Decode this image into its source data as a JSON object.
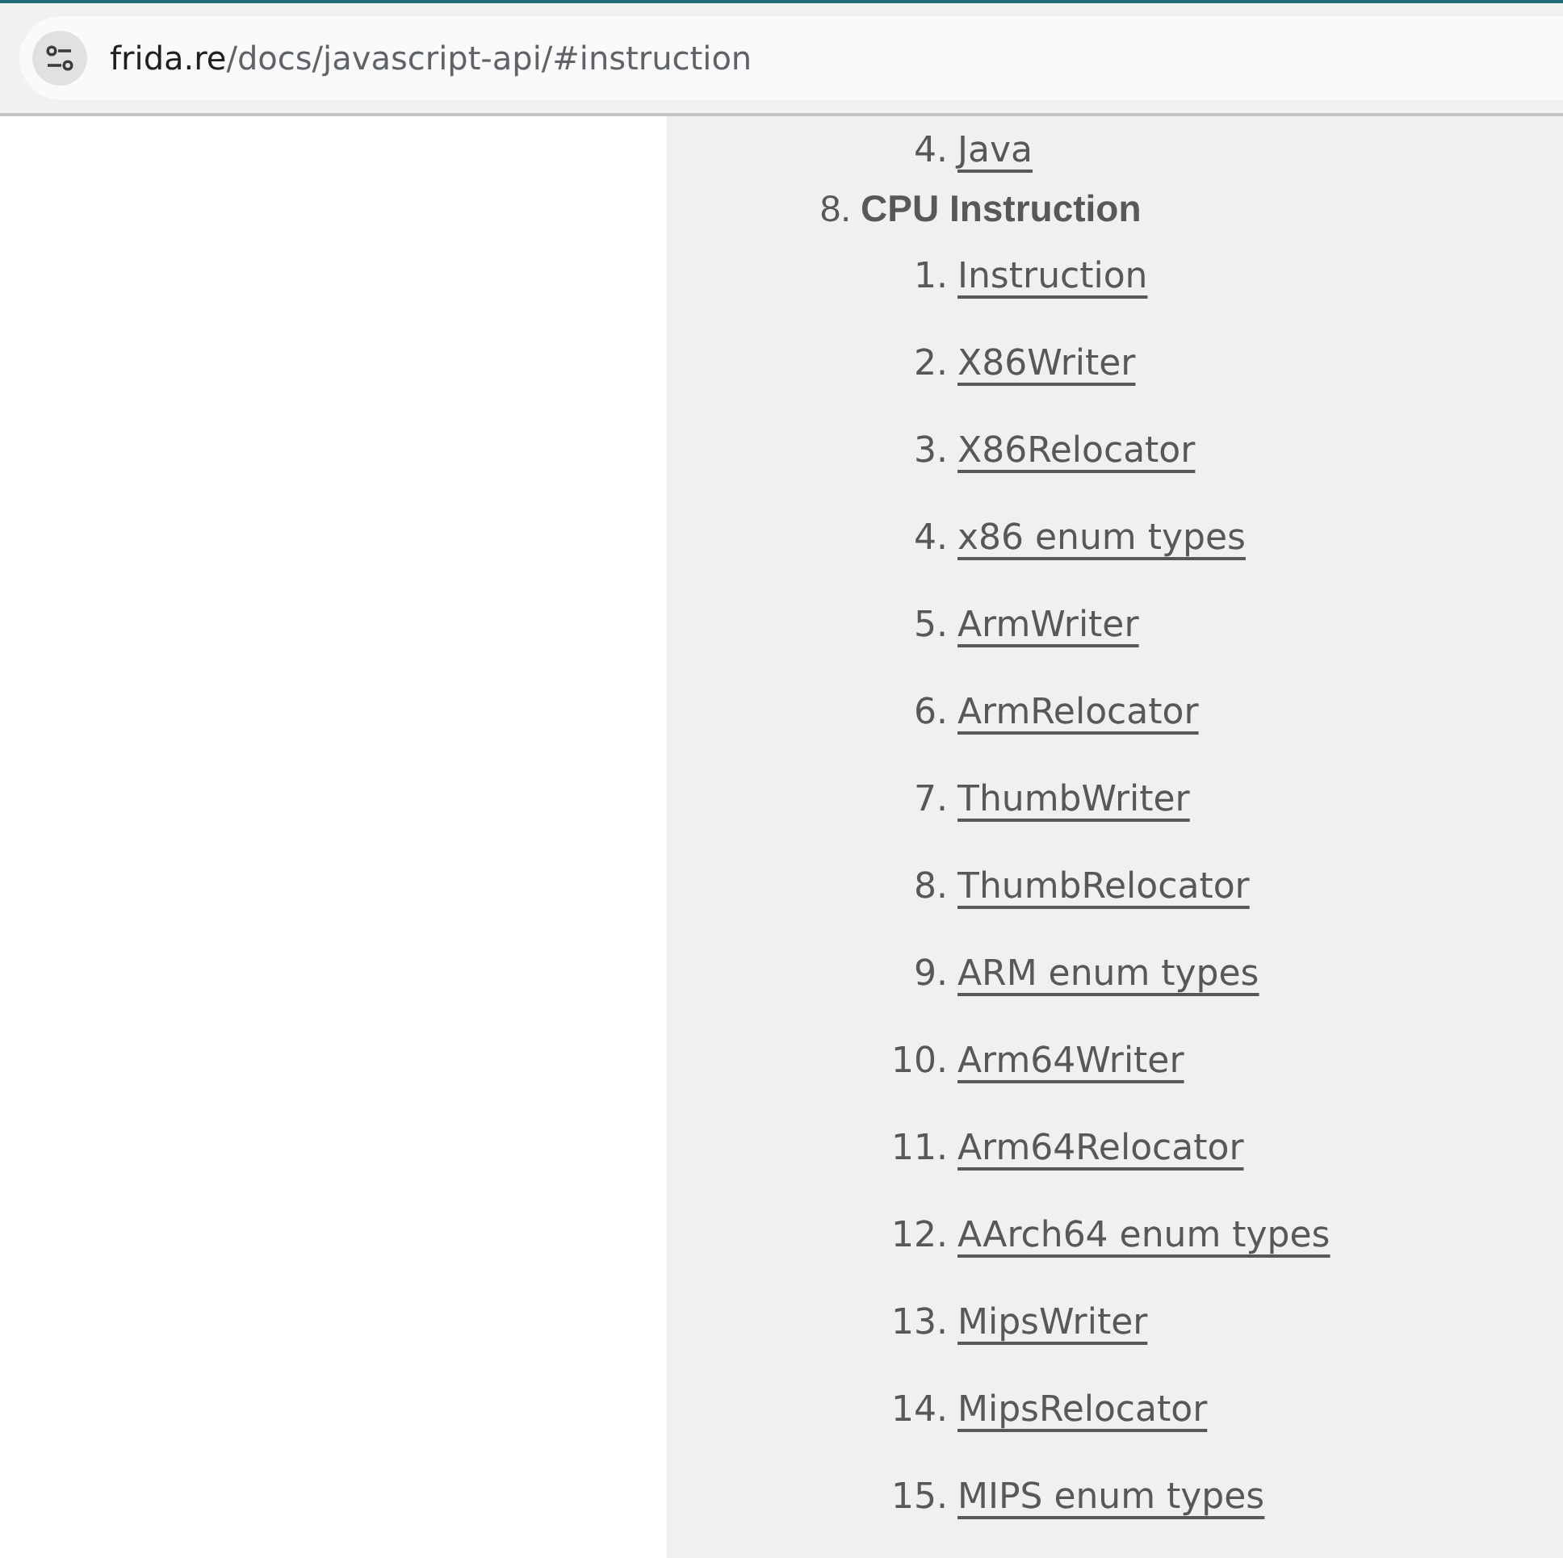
{
  "browser": {
    "url": {
      "host": "frida.re",
      "path": "/docs/javascript-api/#instruction"
    }
  },
  "sidebar": {
    "continued_items": [
      {
        "number": "4.",
        "label": "Java"
      }
    ],
    "sections": [
      {
        "number": "8.",
        "title": "CPU Instruction",
        "children": [
          {
            "number": "1.",
            "label": "Instruction"
          },
          {
            "number": "2.",
            "label": "X86Writer"
          },
          {
            "number": "3.",
            "label": "X86Relocator"
          },
          {
            "number": "4.",
            "label": "x86 enum types"
          },
          {
            "number": "5.",
            "label": "ArmWriter"
          },
          {
            "number": "6.",
            "label": "ArmRelocator"
          },
          {
            "number": "7.",
            "label": "ThumbWriter"
          },
          {
            "number": "8.",
            "label": "ThumbRelocator"
          },
          {
            "number": "9.",
            "label": "ARM enum types"
          },
          {
            "number": "10.",
            "label": "Arm64Writer"
          },
          {
            "number": "11.",
            "label": "Arm64Relocator"
          },
          {
            "number": "12.",
            "label": "AArch64 enum types"
          },
          {
            "number": "13.",
            "label": "MipsWriter"
          },
          {
            "number": "14.",
            "label": "MipsRelocator"
          },
          {
            "number": "15.",
            "label": "MIPS enum types"
          }
        ]
      }
    ]
  }
}
